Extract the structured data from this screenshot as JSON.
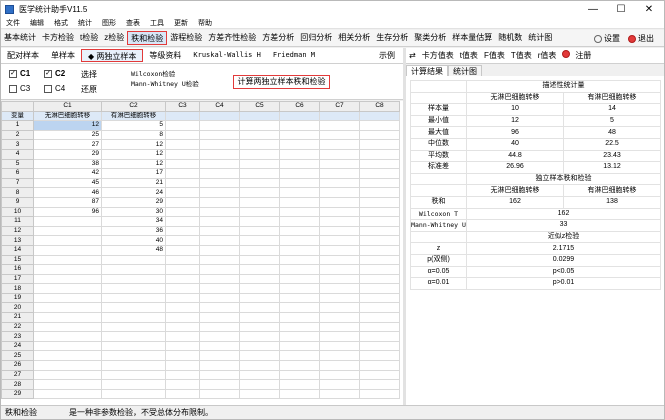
{
  "window": {
    "title": "医学统计助手V11.5",
    "minimize": "—",
    "maximize": "☐",
    "close": "✕"
  },
  "menu": [
    "文件",
    "编辑",
    "格式",
    "统计",
    "图形",
    "查表",
    "工具",
    "更新",
    "帮助"
  ],
  "toolbar": {
    "items": [
      "基本统计",
      "卡方检验",
      "t检验",
      "z检验",
      "秩和检验",
      "游程检验",
      "方差齐性检验",
      "方差分析",
      "回归分析",
      "相关分析",
      "生存分析",
      "聚类分析",
      "样本量估算",
      "随机数",
      "统计图"
    ],
    "active_index": 4,
    "settings": "设置",
    "exit": "退出"
  },
  "subtabs": {
    "items": [
      "配对样本",
      "单样本",
      "两独立样本",
      "等级资料",
      "Kruskal-Wallis H",
      "Friedman M"
    ],
    "active_index": 2,
    "active_marker": "◆",
    "example": "示例"
  },
  "options": {
    "c1": {
      "label": "C1",
      "checked": true
    },
    "c2": {
      "label": "C2",
      "checked": true
    },
    "c3": {
      "label": "C3",
      "checked": false
    },
    "c4": {
      "label": "C4",
      "checked": false
    },
    "select": "选择",
    "restore": "还原",
    "method1": "Wilcoxon检验",
    "method2": "Mann-Whitney U检验",
    "calc_button": "计算两独立样本秩和检验"
  },
  "grid": {
    "col_headers": [
      "",
      "C1",
      "C2",
      "C3",
      "C4",
      "C5",
      "C6",
      "C7",
      "C8"
    ],
    "var_label": "变量",
    "labels": [
      "无淋巴细胞转移",
      "有淋巴细胞转移"
    ],
    "row_numbers": [
      "1",
      "2",
      "3",
      "4",
      "5",
      "6",
      "7",
      "8",
      "9",
      "10",
      "11",
      "12",
      "13",
      "14",
      "15",
      "16",
      "17",
      "18",
      "19",
      "20",
      "21",
      "22",
      "23",
      "24",
      "25",
      "26",
      "27",
      "28",
      "29"
    ],
    "c1": [
      "12",
      "25",
      "27",
      "29",
      "38",
      "42",
      "45",
      "46",
      "87",
      "96",
      "",
      "",
      "",
      "",
      "",
      "",
      "",
      "",
      "",
      "",
      "",
      "",
      "",
      "",
      "",
      "",
      "",
      "",
      ""
    ],
    "c2": [
      "5",
      "8",
      "12",
      "12",
      "12",
      "17",
      "21",
      "24",
      "29",
      "30",
      "34",
      "36",
      "40",
      "48",
      "",
      "",
      "",
      "",
      "",
      "",
      "",
      "",
      "",
      "",
      "",
      "",
      "",
      "",
      ""
    ]
  },
  "right_panel": {
    "tabs": [
      "卡方值表",
      "t值表",
      "F值表",
      "T值表",
      "r值表",
      "注册"
    ],
    "swap_icon": "⇄",
    "subtabs": [
      "计算结果",
      "统计图"
    ],
    "results": {
      "desc_title": "描述性统计量",
      "groups": [
        "无淋巴细胞转移",
        "有淋巴细胞转移"
      ],
      "rows": [
        {
          "label": "样本量",
          "a": "10",
          "b": "14"
        },
        {
          "label": "最小值",
          "a": "12",
          "b": "5"
        },
        {
          "label": "最大值",
          "a": "96",
          "b": "48"
        },
        {
          "label": "中位数",
          "a": "40",
          "b": "22.5"
        },
        {
          "label": "平均数",
          "a": "44.8",
          "b": "23.43"
        },
        {
          "label": "标准差",
          "a": "26.96",
          "b": "13.12"
        }
      ],
      "rank_title": "独立样本秩和检验",
      "rank_sum_label": "秩和",
      "rank_sum": [
        "162",
        "138"
      ],
      "wilcoxon_label": "Wilcoxon T",
      "wilcoxon_value": "162",
      "mw_label": "Mann-Whitney U",
      "mw_value": "33",
      "z_title": "近似z检验",
      "z_label": "z",
      "z_value": "2.1715",
      "p_label": "p(双侧)",
      "p_value": "0.0299",
      "alpha1_label": "α=0.05",
      "alpha1_value": "p<0.05",
      "alpha2_label": "α=0.01",
      "alpha2_value": "p>0.01"
    }
  },
  "status": {
    "left": "秩和检验",
    "right": "是一种非参数检验，不受总体分布限制。"
  }
}
